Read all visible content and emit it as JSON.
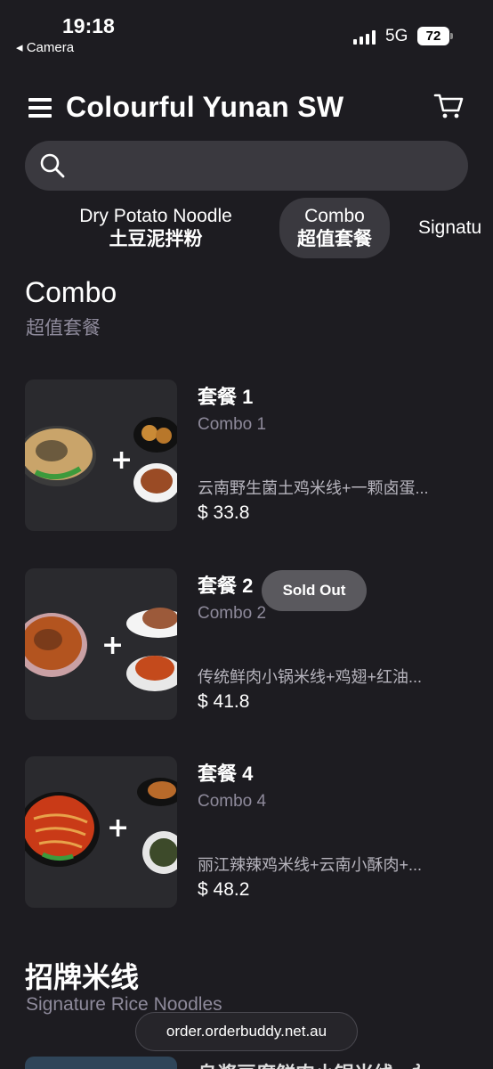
{
  "status_bar": {
    "time": "19:18",
    "back_label": "◂ Camera",
    "network": "5G",
    "battery": "72"
  },
  "header": {
    "title": "Colourful Yunan SW"
  },
  "search": {
    "placeholder": ""
  },
  "categories": [
    {
      "en": "Dry Potato Noodle",
      "zh": "土豆泥拌粉",
      "active": false
    },
    {
      "en": "Combo",
      "zh": "超值套餐",
      "active": true
    },
    {
      "en": "Signatu",
      "zh": "",
      "active": false
    }
  ],
  "sections": [
    {
      "title": "Combo",
      "subtitle": "超值套餐",
      "items": [
        {
          "name": "套餐 1",
          "en": "Combo 1",
          "desc": "云南野生菌土鸡米线+一颗卤蛋...",
          "price": "$ 33.8",
          "badge": ""
        },
        {
          "name": "套餐 2",
          "en": "Combo 2",
          "desc": "传统鲜肉小锅米线+鸡翅+红油...",
          "price": "$ 41.8",
          "badge": "Sold Out"
        },
        {
          "name": "套餐 4",
          "en": "Combo 4",
          "desc": "丽江辣辣鸡米线+云南小酥肉+...",
          "price": "$ 48.2",
          "badge": ""
        }
      ]
    },
    {
      "title": "招牌米线",
      "subtitle": "Signature Rice Noodles",
      "next_item_name": "乌酱豆腐鲜肉小锅米线 🌶"
    }
  ],
  "footer": {
    "url": "order.orderbuddy.net.au"
  },
  "colors": {
    "background": "#1d1c21",
    "surface": "#3a393f",
    "muted": "#8e8a9b"
  }
}
